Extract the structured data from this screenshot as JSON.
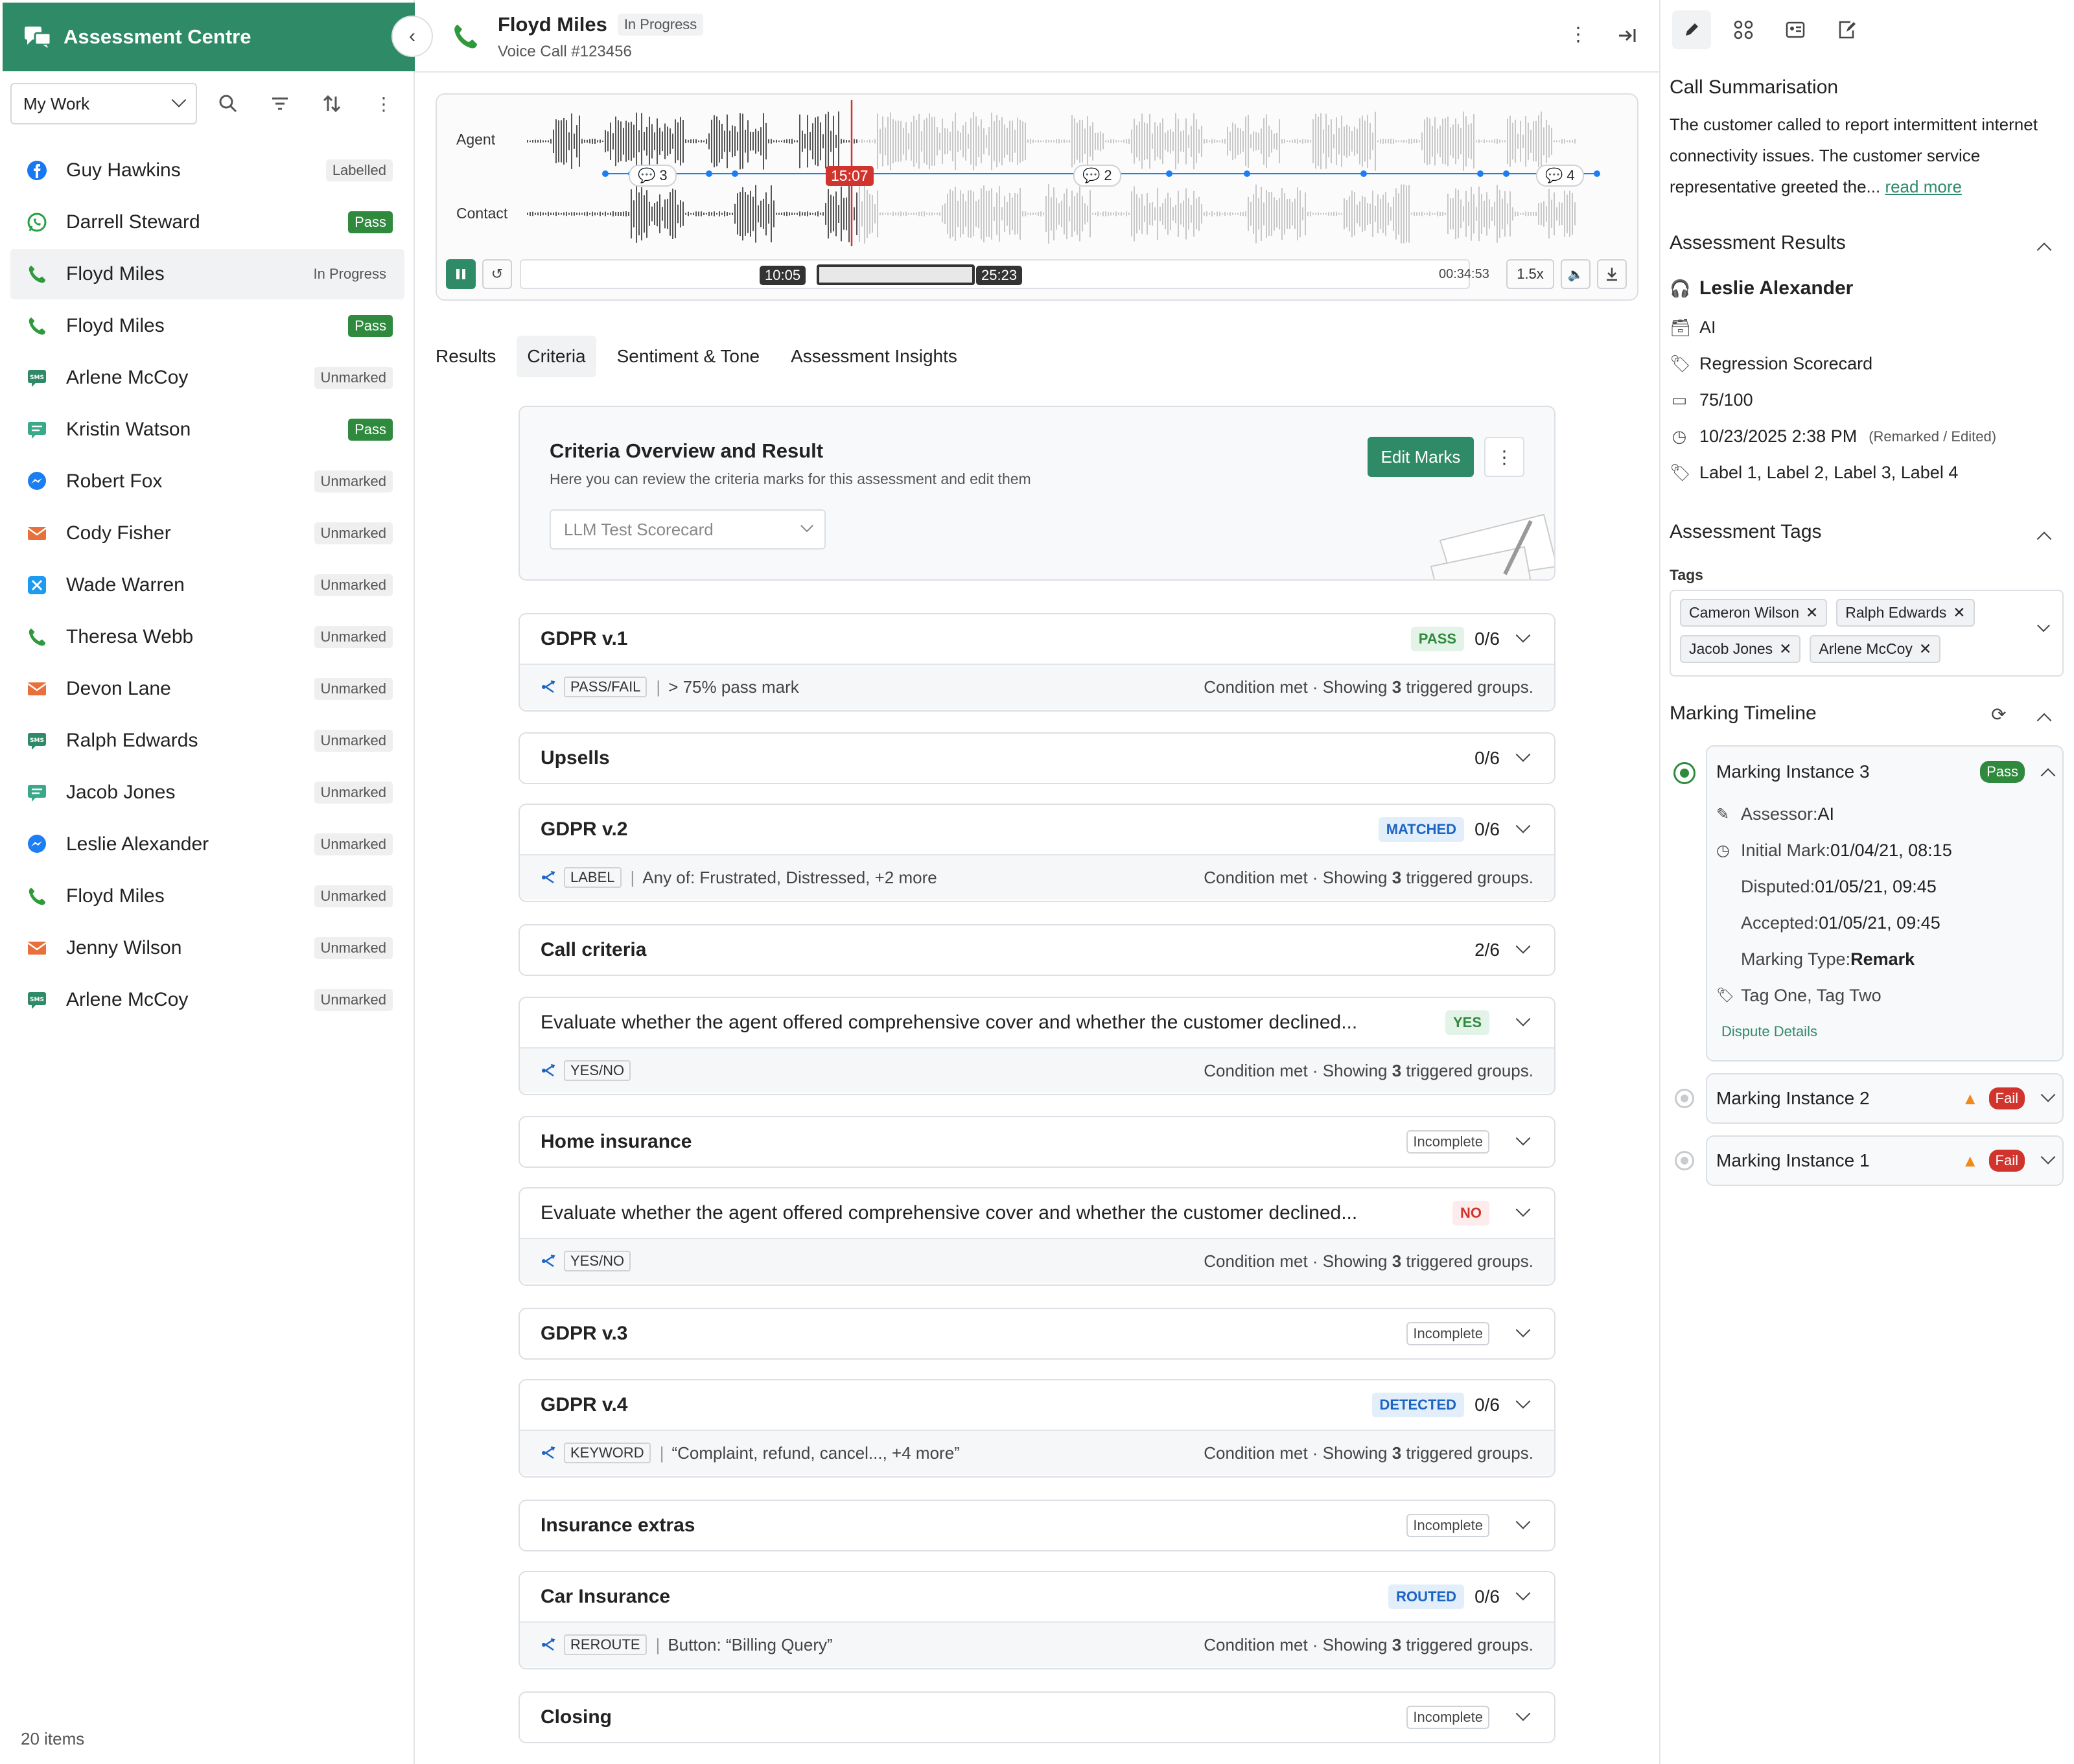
{
  "app": {
    "title": "Assessment Centre",
    "view": "My Work",
    "items_count": "20 items"
  },
  "conversations": [
    {
      "name": "Guy Hawkins",
      "channel": "facebook",
      "status": "Labelled",
      "kind": "plain"
    },
    {
      "name": "Darrell Steward",
      "channel": "whatsapp",
      "status": "Pass",
      "kind": "pass"
    },
    {
      "name": "Floyd Miles",
      "channel": "phone",
      "status": "In Progress",
      "kind": "prog"
    },
    {
      "name": "Floyd Miles",
      "channel": "phone",
      "status": "Pass",
      "kind": "pass"
    },
    {
      "name": "Arlene McCoy",
      "channel": "sms",
      "status": "Unmarked",
      "kind": "plain"
    },
    {
      "name": "Kristin Watson",
      "channel": "chat",
      "status": "Pass",
      "kind": "pass"
    },
    {
      "name": "Robert Fox",
      "channel": "messenger",
      "status": "Unmarked",
      "kind": "plain"
    },
    {
      "name": "Cody Fisher",
      "channel": "email",
      "status": "Unmarked",
      "kind": "plain"
    },
    {
      "name": "Wade Warren",
      "channel": "x",
      "status": "Unmarked",
      "kind": "plain"
    },
    {
      "name": "Theresa Webb",
      "channel": "phone",
      "status": "Unmarked",
      "kind": "plain"
    },
    {
      "name": "Devon Lane",
      "channel": "email",
      "status": "Unmarked",
      "kind": "plain"
    },
    {
      "name": "Ralph Edwards",
      "channel": "sms",
      "status": "Unmarked",
      "kind": "plain"
    },
    {
      "name": "Jacob Jones",
      "channel": "chat",
      "status": "Unmarked",
      "kind": "plain"
    },
    {
      "name": "Leslie Alexander",
      "channel": "messenger",
      "status": "Unmarked",
      "kind": "plain"
    },
    {
      "name": "Floyd Miles",
      "channel": "phone",
      "status": "Unmarked",
      "kind": "plain"
    },
    {
      "name": "Jenny Wilson",
      "channel": "email",
      "status": "Unmarked",
      "kind": "plain"
    },
    {
      "name": "Arlene McCoy",
      "channel": "sms",
      "status": "Unmarked",
      "kind": "plain"
    }
  ],
  "header": {
    "name": "Floyd Miles",
    "status": "In Progress",
    "subtitle": "Voice Call #123456"
  },
  "player": {
    "agent_label": "Agent",
    "contact_label": "Contact",
    "playhead": "15:07",
    "comments": [
      "3",
      "2",
      "4"
    ],
    "seg_start": "10:05",
    "seg_end": "25:23",
    "duration": "00:34:53",
    "speed": "1.5x"
  },
  "tabs": [
    "Results",
    "Criteria",
    "Sentiment & Tone",
    "Assessment Insights"
  ],
  "overview": {
    "title": "Criteria Overview and Result",
    "desc": "Here you can review the criteria marks for this assessment and edit them",
    "select": "LLM Test Scorecard",
    "edit": "Edit Marks"
  },
  "criteria": [
    {
      "title": "GDPR v.1",
      "pill": "PASS",
      "pc": "green",
      "score": "0/6",
      "tag": "PASS/FAIL",
      "detail": "> 75% pass mark",
      "cond": [
        "Condition met · Showing ",
        "3",
        " triggered groups."
      ]
    },
    {
      "title": "Upsells",
      "pill": "",
      "pc": "",
      "score": "0/6"
    },
    {
      "title": "GDPR v.2",
      "pill": "MATCHED",
      "pc": "blue",
      "score": "0/6",
      "tag": "LABEL",
      "detail": "Any of:  Frustrated, Distressed, +2 more",
      "cond": [
        "Condition met · Showing ",
        "3",
        " triggered groups."
      ]
    },
    {
      "title": "Call criteria",
      "pill": "",
      "pc": "",
      "score": "2/6"
    },
    {
      "title": "Evaluate whether the agent offered comprehensive cover and whether the customer declined...",
      "pill": "YES",
      "pc": "green",
      "score": "",
      "tag": "YES/NO",
      "detail": "",
      "cond": [
        "Condition met · Showing ",
        "3",
        " triggered groups."
      ],
      "thin": true
    },
    {
      "title": "Home insurance",
      "pill": "Incomplete",
      "pc": "inc",
      "score": ""
    },
    {
      "title": "Evaluate whether the agent offered comprehensive cover and whether the customer declined...",
      "pill": "NO",
      "pc": "red",
      "score": "",
      "tag": "YES/NO",
      "detail": "",
      "cond": [
        "Condition met · Showing ",
        "3",
        " triggered groups."
      ],
      "thin": true
    },
    {
      "title": "GDPR v.3",
      "pill": "Incomplete",
      "pc": "inc",
      "score": ""
    },
    {
      "title": "GDPR v.4",
      "pill": "DETECTED",
      "pc": "blue",
      "score": "0/6",
      "tag": "KEYWORD",
      "detail": "“Complaint, refund, cancel..., +4 more”",
      "cond": [
        "Condition met · Showing ",
        "3",
        " triggered groups."
      ]
    },
    {
      "title": "Insurance extras",
      "pill": "Incomplete",
      "pc": "inc",
      "score": ""
    },
    {
      "title": "Car Insurance",
      "pill": "ROUTED",
      "pc": "blue",
      "score": "0/6",
      "tag": "REROUTE",
      "detail": "Button: “Billing Query”",
      "cond": [
        "Condition met · Showing ",
        "3",
        " triggered groups."
      ]
    },
    {
      "title": "Closing",
      "pill": "Incomplete",
      "pc": "inc",
      "score": ""
    }
  ],
  "summary": {
    "title": "Call Summarisation",
    "text": "The customer called to report intermittent internet connectivity issues. The customer service representative greeted the...",
    "more": "read more"
  },
  "results": {
    "title": "Assessment Results",
    "person": "Leslie Alexander",
    "assessor": "AI",
    "scorecard": "Regression Scorecard",
    "score": "75/100",
    "date": "10/23/2025 2:38 PM",
    "date_note": "(Remarked / Edited)",
    "labels": "Label 1, Label 2, Label 3, Label 4"
  },
  "tags": {
    "title": "Assessment Tags",
    "label": "Tags",
    "chips": [
      "Cameron Wilson",
      "Ralph Edwards",
      "Jacob Jones",
      "Arlene McCoy"
    ]
  },
  "timeline": {
    "title": "Marking Timeline",
    "instances": [
      {
        "name": "Marking Instance 3",
        "status": "Pass",
        "assessor_label": "Assessor: ",
        "assessor": "AI",
        "initial_label": "Initial Mark: ",
        "initial": "01/04/21, 08:15",
        "disputed_label": "Disputed: ",
        "disputed": "01/05/21, 09:45",
        "accepted_label": "Accepted: ",
        "accepted": "01/05/21, 09:45",
        "type_label": "Marking Type: ",
        "type": "Remark",
        "tags": "Tag One, Tag Two",
        "link": "Dispute Details"
      },
      {
        "name": "Marking Instance 2",
        "status": "Fail"
      },
      {
        "name": "Marking Instance 1",
        "status": "Fail"
      }
    ]
  },
  "colors": {
    "brand": "#2f8a68",
    "pass": "#2f8a3e",
    "fail": "#d0342c",
    "playhead": "#d0342c",
    "link": "#1c64c4"
  }
}
